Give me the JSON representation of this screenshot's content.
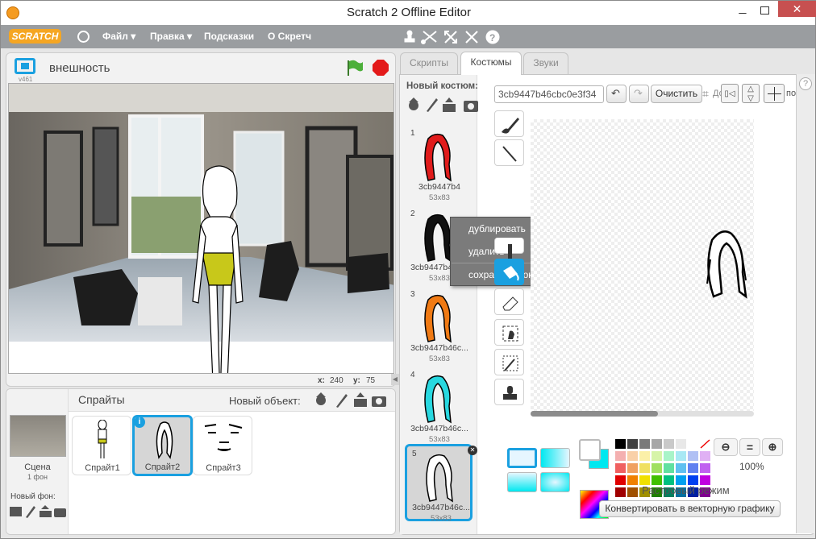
{
  "window": {
    "title": "Scratch 2 Offline Editor"
  },
  "menu": {
    "logo": "SCRATCH",
    "items": [
      "Файл ▾",
      "Правка ▾",
      "Подсказки",
      "О Скретч"
    ]
  },
  "stage": {
    "version": "v461",
    "name": "внешность",
    "x_label": "x:",
    "x_value": "240",
    "y_label": "y:",
    "y_value": "75"
  },
  "sprites_panel": {
    "title": "Спрайты",
    "new_object_label": "Новый объект:",
    "scene_label": "Сцена",
    "scene_count": "1 фон",
    "new_backdrop_label": "Новый фон:",
    "sprites": [
      {
        "name": "Спрайт1",
        "selected": false
      },
      {
        "name": "Спрайт2",
        "selected": true
      },
      {
        "name": "Спрайт3",
        "selected": false
      }
    ]
  },
  "tabs": [
    "Скрипты",
    "Костюмы",
    "Звуки"
  ],
  "active_tab": "Костюмы",
  "costumes_panel": {
    "new_costume_label": "Новый костюм:",
    "costumes": [
      {
        "num": "1",
        "name": "3cb9447b4",
        "size": "53x83",
        "color": "#e01b1b"
      },
      {
        "num": "2",
        "name": "3cb9447b46c...",
        "size": "53x83",
        "color": "#111111"
      },
      {
        "num": "3",
        "name": "3cb9447b46c...",
        "size": "53x83",
        "color": "#f07a14"
      },
      {
        "num": "4",
        "name": "3cb9447b46c...",
        "size": "53x83",
        "color": "#28d8e0"
      },
      {
        "num": "5",
        "name": "3cb9447b46c...",
        "size": "53x83",
        "color": "#ffffff"
      }
    ],
    "selected_index": 4
  },
  "context_menu": {
    "items": [
      "дублировать",
      "удалить",
      "сохранить локальный файл"
    ]
  },
  "editor": {
    "costume_name": "3cb9447b46cbc0e3f34",
    "clear_label": "Очистить",
    "import_label": "До",
    "paste_label": "по",
    "zoom": "100%",
    "mode_label": "Растровый режим",
    "convert_label": "Конвертировать в векторную графику",
    "help": "?"
  },
  "palette": [
    [
      "#000000",
      "#404040",
      "#7a7a7a",
      "#a6a6a6",
      "#c9c9c9",
      "#e8e8e8",
      "#ffffff",
      "none"
    ],
    [
      "#f4b0b0",
      "#f9d0a8",
      "#fbf0a8",
      "#d6f4a8",
      "#a8f4c8",
      "#a8e8f4",
      "#b0c0f4",
      "#e0b0f4"
    ],
    [
      "#f06060",
      "#f0a060",
      "#f0e060",
      "#a0e060",
      "#60e0a0",
      "#60c0f0",
      "#6080f0",
      "#c060f0"
    ],
    [
      "#e00000",
      "#f08000",
      "#f0e000",
      "#40c000",
      "#00c080",
      "#00a0f0",
      "#0040f0",
      "#c000e0"
    ],
    [
      "#a00000",
      "#a05000",
      "#a09000",
      "#208000",
      "#008060",
      "#0070a0",
      "#0020a0",
      "#800090"
    ]
  ],
  "colors": {
    "accent_blue": "#1aa0e0",
    "title_bg": "#9a9da0",
    "selected_tool": "#1aa0e0",
    "primary_color": "#ffffff",
    "secondary_color": "#00e8f0"
  }
}
